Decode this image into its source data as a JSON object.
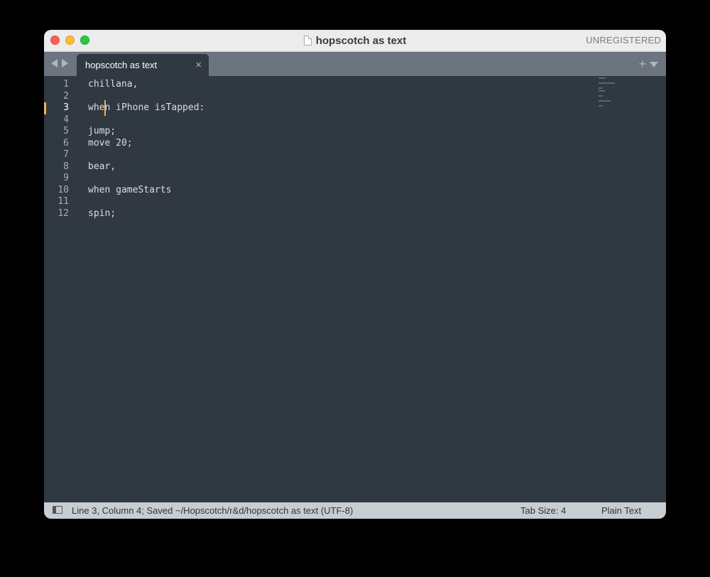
{
  "window": {
    "title": "hopscotch as text",
    "registration": "UNREGISTERED"
  },
  "tabs": [
    {
      "label": "hopscotch as text",
      "close": "×",
      "active": true
    }
  ],
  "tabbar": {
    "new_tab": "+"
  },
  "editor": {
    "current_line": 3,
    "lines": [
      {
        "num": "1",
        "text": "chillana,"
      },
      {
        "num": "2",
        "text": ""
      },
      {
        "num": "3",
        "text": "when iPhone isTapped:"
      },
      {
        "num": "4",
        "text": ""
      },
      {
        "num": "5",
        "text": "jump;"
      },
      {
        "num": "6",
        "text": "move 20;"
      },
      {
        "num": "7",
        "text": ""
      },
      {
        "num": "8",
        "text": "bear,"
      },
      {
        "num": "9",
        "text": ""
      },
      {
        "num": "10",
        "text": "when gameStarts"
      },
      {
        "num": "11",
        "text": ""
      },
      {
        "num": "12",
        "text": "spin;"
      }
    ]
  },
  "status": {
    "position": "Line 3, Column 4; Saved ~/Hopscotch/r&d/hopscotch as text (UTF-8)",
    "tab_size": "Tab Size: 4",
    "syntax": "Plain Text"
  },
  "colors": {
    "editor_bg": "#303841",
    "caret": "#f9ae58",
    "text": "#d8dee9"
  },
  "icons": [
    "document-icon",
    "back-arrow-icon",
    "forward-arrow-icon",
    "close-icon",
    "plus-icon",
    "dropdown-icon",
    "sidebar-toggle-icon"
  ]
}
